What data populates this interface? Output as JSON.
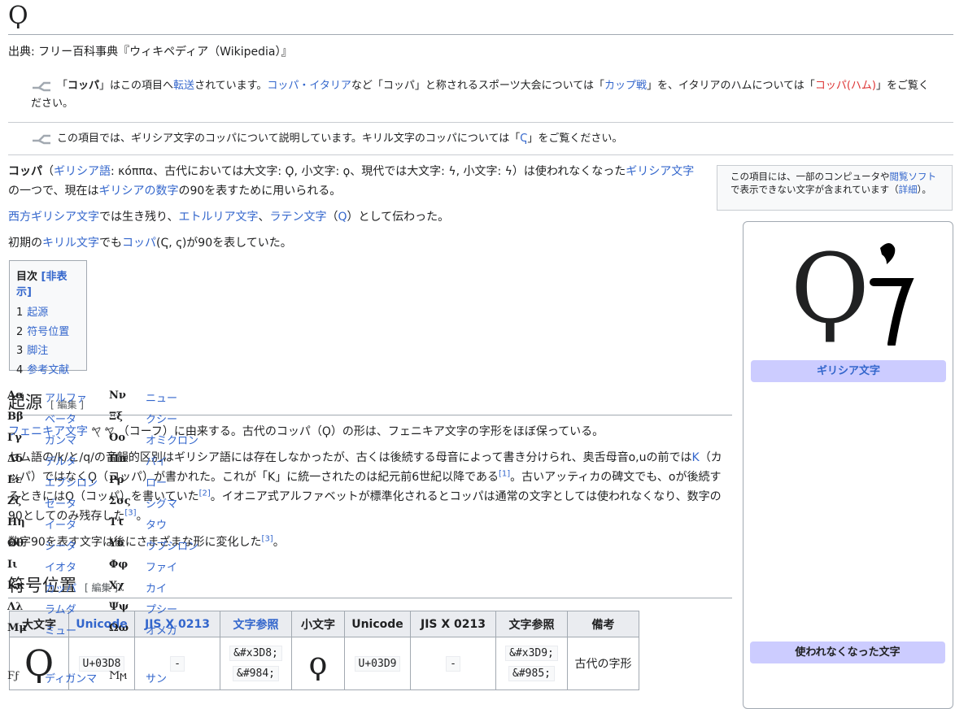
{
  "title": "Ϙ",
  "from_line": "出典: フリー百科事典『ウィキペディア（Wikipedia）』",
  "hatnote1": {
    "pre": "「",
    "bold": "コッパ",
    "t1": "」はこの項目へ",
    "link1": "転送",
    "t2": "されています。",
    "link2": "コッパ・イタリア",
    "t3": "など「コッパ」と称されるスポーツ大会については「",
    "link3": "カップ戦",
    "t4": "」を、イタリアのハムについては「",
    "link4": "コッパ(ハム)",
    "t5": "」をご覧ください。"
  },
  "hatnote2": {
    "t1": "この項目では、ギリシア文字のコッパについて説明しています。キリル文字のコッパについては「",
    "link1": "Ҁ",
    "t2": "」をご覧ください。"
  },
  "lead": {
    "p1": {
      "bold": "コッパ",
      "t1": "（",
      "link1": "ギリシア語",
      "t2": ": κόππα、古代においては大文字: Ϙ, 小文字: ϙ、現代では大文字: ϟ, 小文字: ϟ）は使われなくなった",
      "link2": "ギリシア文字",
      "t3": "の一つで、現在は",
      "link3": "ギリシアの数字",
      "t4": "の90を表すために用いられる。"
    },
    "p2": {
      "link1": "西方ギリシア文字",
      "t1": "では生き残り、",
      "link2": "エトルリア文字",
      "t2": "、",
      "link3": "ラテン文字",
      "t3": "（",
      "link4": "Q",
      "t4": "）として伝わった。"
    },
    "p3": {
      "t1": "初期の",
      "link1": "キリル文字",
      "t2": "でも",
      "link2": "コッパ",
      "t3": "(Ҁ, ҁ)が90を表していた。"
    }
  },
  "notice": {
    "t1": "この項目には、一部のコンピュータや",
    "link1": "閲覧ソフト",
    "t2": "で表示できない文字が含まれています（",
    "link2": "詳細",
    "t3": "）。"
  },
  "toc": {
    "title": "目次",
    "toggle": "[非表示]",
    "items": [
      {
        "num": "1",
        "label": "起源"
      },
      {
        "num": "2",
        "label": "符号位置"
      },
      {
        "num": "3",
        "label": "脚注"
      },
      {
        "num": "4",
        "label": "参考文献"
      }
    ]
  },
  "section1": {
    "heading": "起源",
    "edit": "[ 編集 ]",
    "p1": {
      "link1": "フェニキア文字",
      "t1": " 𐤒 𐤒 （コーフ）に由来する。古代のコッパ（Ϙ）の形は、フェニキア文字の字形をほぼ保っている。"
    },
    "p2": {
      "t1": "セム語の/k/と/q/の音韻的区別はギリシア語には存在しなかったが、古くは後続する母音によって書き分けられ、奥舌母音o,uの前では",
      "link1": "Κ",
      "t2": "（カッパ）ではなくϘ（コッパ）が書かれた。これが「Κ」に統一されたのは紀元前6世紀以降である",
      "ref1": "[1]",
      "t3": "。古いアッティカの碑文でも、oが後続するときにはϘ（コッパ）を書いていた",
      "ref2": "[2]",
      "t4": "。イオニア式アルファベットが標準化されるとコッパは通常の文字としては使われなくなり、数字の90としてのみ残存した",
      "ref3": "[3]",
      "t5": "。"
    },
    "p3": {
      "t1": "数字90を表す文字は後にさまざまな形に変化した",
      "ref1": "[3]",
      "t2": "。"
    }
  },
  "section2": {
    "heading": "符号位置",
    "edit": "[ 編集 ]",
    "headers": [
      "大文字",
      "Unicode",
      "JIS X 0213",
      "文字参照",
      "小文字",
      "Unicode",
      "JIS X 0213",
      "文字参照",
      "備考"
    ],
    "row": {
      "upper": "Ϙ",
      "upper_code": "U+03D8",
      "upper_jis": "-",
      "upper_ref1": "&#x3D8;",
      "upper_ref2": "&#984;",
      "lower": "ϙ",
      "lower_code": "U+03D9",
      "lower_jis": "-",
      "lower_ref1": "&#x3D9;",
      "lower_ref2": "&#985;",
      "note": "古代の字形"
    }
  },
  "infobox": {
    "glyph1": "Ϙ",
    "head1": "ギリシア文字",
    "letters": [
      {
        "u": "Αα",
        "n": "アルファ",
        "u2": "Νν",
        "n2": "ニュー"
      },
      {
        "u": "Ββ",
        "n": "ベータ",
        "u2": "Ξξ",
        "n2": "クシー"
      },
      {
        "u": "Γγ",
        "n": "ガンマ",
        "u2": "Οο",
        "n2": "オミクロン"
      },
      {
        "u": "Δδ",
        "n": "デルタ",
        "u2": "Ππ",
        "n2": "パイ"
      },
      {
        "u": "Εε",
        "n": "エプシロン",
        "u2": "Ρρ",
        "n2": "ロー"
      },
      {
        "u": "Ζζ",
        "n": "ゼータ",
        "u2": "Σσς",
        "n2": "シグマ"
      },
      {
        "u": "Ηη",
        "n": "イータ",
        "u2": "Ττ",
        "n2": "タウ"
      },
      {
        "u": "Θθ",
        "n": "シータ",
        "u2": "Υυ",
        "n2": "ウプシロン"
      },
      {
        "u": "Ιι",
        "n": "イオタ",
        "u2": "Φφ",
        "n2": "ファイ"
      },
      {
        "u": "Κκ",
        "n": "カッパ",
        "u2": "Χχ",
        "n2": "カイ"
      },
      {
        "u": "Λλ",
        "n": "ラムダ",
        "u2": "Ψψ",
        "n2": "プシー"
      },
      {
        "u": "Μμ",
        "n": "ミュー",
        "u2": "Ωω",
        "n2": "オメガ"
      }
    ],
    "head2": "使われなくなった文字",
    "obsolete": [
      {
        "u": "Ϝϝ",
        "n": "ディガンマ",
        "u2": "Ϻϻ",
        "n2": "サン"
      }
    ]
  },
  "colors": {
    "link": "#3366cc",
    "redlink": "#d33",
    "infobox_head": "#ccccff"
  }
}
